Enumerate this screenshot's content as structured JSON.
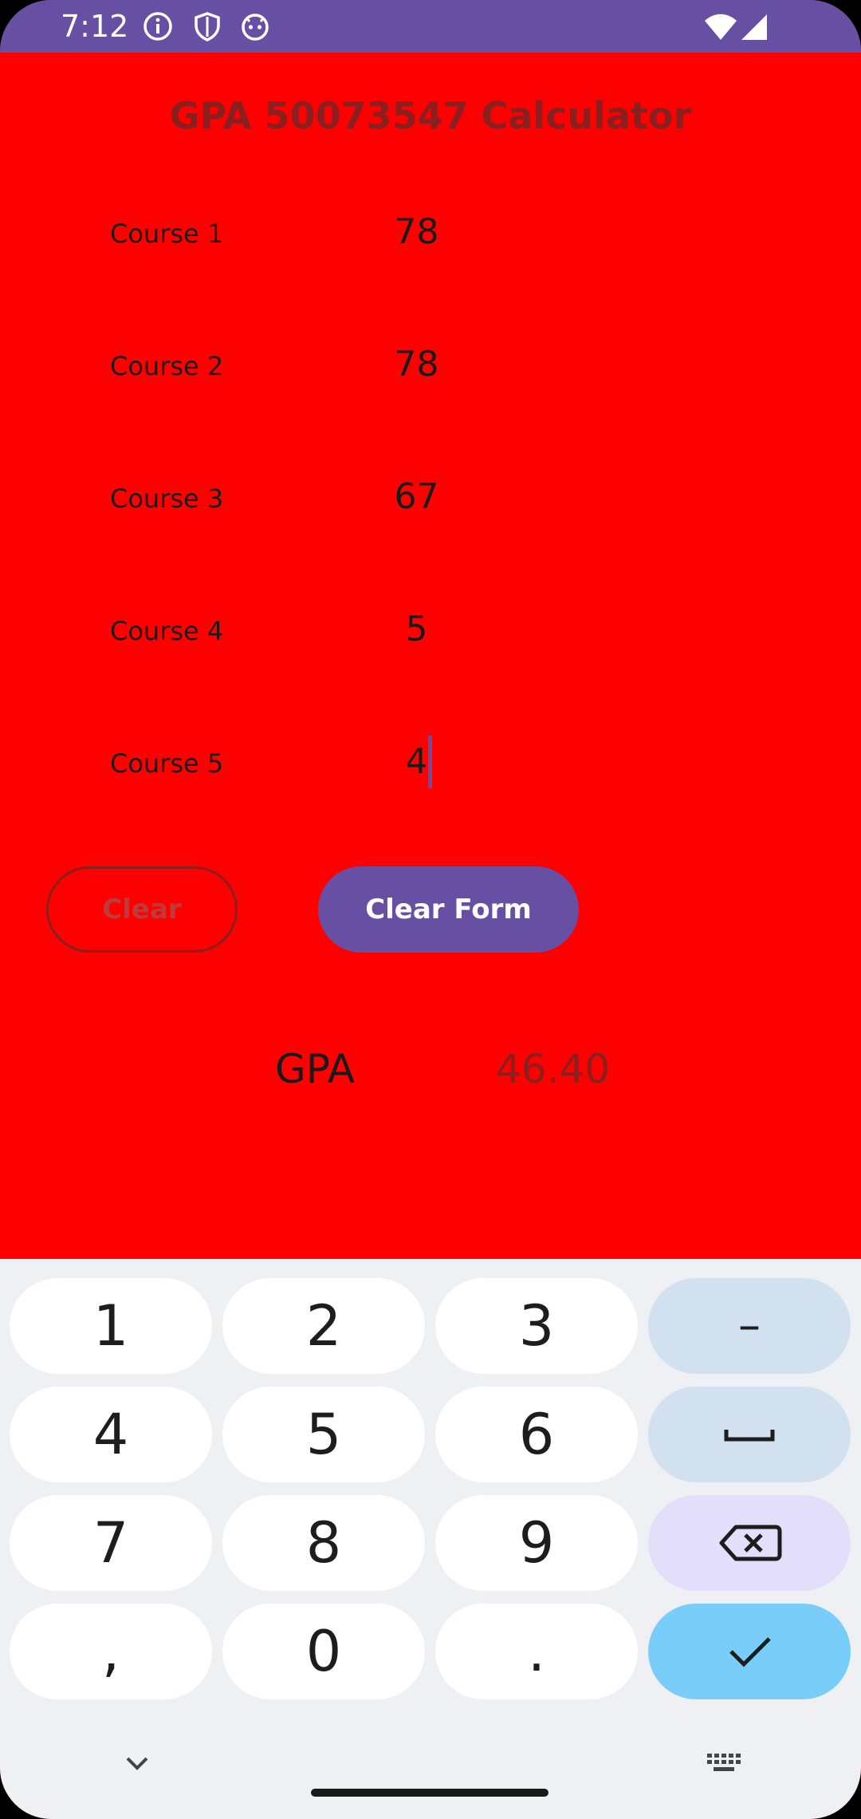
{
  "status_bar": {
    "time": "7:12",
    "icons": [
      "info-icon",
      "shield-icon",
      "android-face-icon",
      "wifi-icon",
      "signal-icon"
    ],
    "color": "#6750a4"
  },
  "app": {
    "title": "GPA 50073547 Calculator",
    "background": "#ff0000",
    "courses": [
      {
        "label": "Course 1",
        "value": "78"
      },
      {
        "label": "Course 2",
        "value": "78"
      },
      {
        "label": "Course 3",
        "value": "67"
      },
      {
        "label": "Course 4",
        "value": "5"
      },
      {
        "label": "Course 5",
        "value": "4"
      }
    ],
    "buttons": {
      "clear": "Clear",
      "clear_form": "Clear Form"
    },
    "gpa": {
      "label": "GPA",
      "value": "46.40"
    }
  },
  "keyboard": {
    "keys": [
      "1",
      "2",
      "3",
      "–",
      "4",
      "5",
      "6",
      "space",
      "7",
      "8",
      "9",
      "backspace",
      ",",
      "0",
      ".",
      "done"
    ]
  }
}
